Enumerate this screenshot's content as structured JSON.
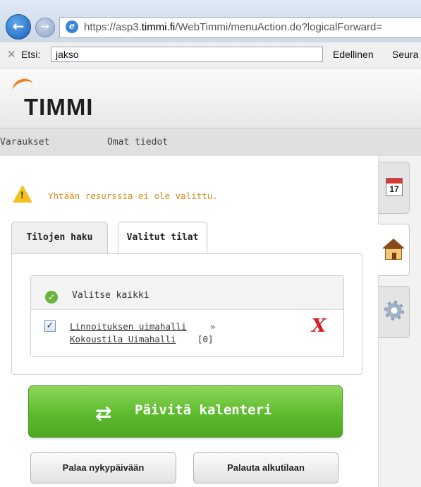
{
  "browser": {
    "url_prefix": "https://asp3.",
    "url_domain": "timmi.fi",
    "url_rest": "/WebTimmi/menuAction.do?logicalForward=",
    "back_glyph": "←",
    "forward_glyph": "→",
    "browser_icon": "e"
  },
  "find_bar": {
    "close_glyph": "✕",
    "label": "Etsi:",
    "value": "jakso",
    "prev_label": "Edellinen",
    "next_label": "Seura"
  },
  "app": {
    "logo_text": "TIMMI",
    "nav": [
      "Varaukset",
      "Omat tiedot"
    ]
  },
  "warning": {
    "text": "Yhtään resurssia ei ole valittu."
  },
  "tabs": [
    {
      "label": "Tilojen haku",
      "active": false
    },
    {
      "label": "Valitut tilat",
      "active": true
    }
  ],
  "selection": {
    "select_all_label": "Valitse kaikki",
    "items": [
      {
        "checked": true,
        "facility": "Linnoituksen uimahalli",
        "separator": "»",
        "room": "Kokoustila Uimahalli",
        "count": "[0]",
        "remove_glyph": "X"
      }
    ]
  },
  "actions": {
    "update_label": "Päivitä kalenteri",
    "update_arrows": "⇄",
    "today_label": "Palaa nykypäivään",
    "reset_label": "Palauta alkutilaan"
  },
  "side_tabs": {
    "calendar_day": "17",
    "icons": [
      "calendar-icon",
      "house-icon",
      "gear-icon"
    ]
  },
  "colors": {
    "warning_text": "#d98b18",
    "update_button": "#5dbb2d",
    "remove_icon": "#d81c1c",
    "logo_accent": "#ef7d1a"
  }
}
